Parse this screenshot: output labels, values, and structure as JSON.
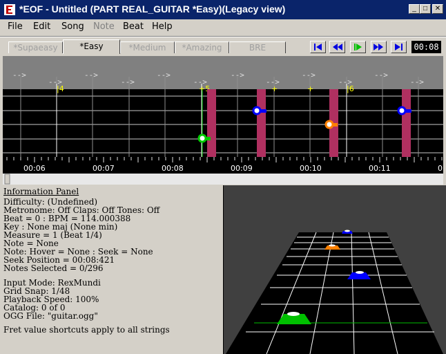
{
  "window": {
    "title": "*EOF - Untitled (PART REAL_GUITAR  *Easy)(Legacy view)",
    "app_icon": "eof-app-icon",
    "controls": [
      "minimize",
      "maximize",
      "close"
    ]
  },
  "menu": {
    "items": [
      {
        "label": "File",
        "enabled": true
      },
      {
        "label": "Edit",
        "enabled": true
      },
      {
        "label": "Song",
        "enabled": true
      },
      {
        "label": "Note",
        "enabled": false
      },
      {
        "label": "Beat",
        "enabled": true
      },
      {
        "label": "Help",
        "enabled": true
      }
    ]
  },
  "tabs": [
    {
      "label": "*Supaeasy",
      "active": false
    },
    {
      "label": "*Easy",
      "active": true
    },
    {
      "label": "*Medium",
      "active": false
    },
    {
      "label": "*Amazing",
      "active": false
    },
    {
      "label": "BRE",
      "active": false
    }
  ],
  "playback": {
    "buttons": [
      "seek-start-icon",
      "rewind-icon",
      "play-icon",
      "fast-forward-icon",
      "seek-end-icon"
    ],
    "time": "00:08"
  },
  "editor": {
    "beat_marker": "-->",
    "measure_labels": [
      "|4",
      "+5",
      "+",
      "+",
      "|6"
    ],
    "time_labels": [
      "00:06",
      "00:07",
      "00:08",
      "00:09",
      "00:10",
      "00:11",
      "0"
    ],
    "note_colors": {
      "green": "#00cc00",
      "blue": "#0000ff",
      "orange": "#ff8000",
      "marker": "#b03060"
    }
  },
  "info": {
    "header": "Information Panel",
    "lines": [
      "Difficulty: (Undefined)",
      "Metronome: Off Claps: Off Tones: Off",
      "Beat = 0 : BPM = 114.000388",
      "Key : None maj (None min)",
      "Measure = 1 (Beat 1/4)",
      "Note = None",
      "Note: Hover = None : Seek = None",
      "Seek Position = 00:08:421",
      "Notes Selected = 0/296"
    ],
    "lines2": [
      "Input Mode: RexMundi",
      "Grid Snap: 1/48",
      "Playback Speed: 100%",
      "Catalog: 0  of  0",
      "OGG File: \"guitar.ogg\""
    ],
    "footer": "Fret value shortcuts apply to all strings"
  }
}
